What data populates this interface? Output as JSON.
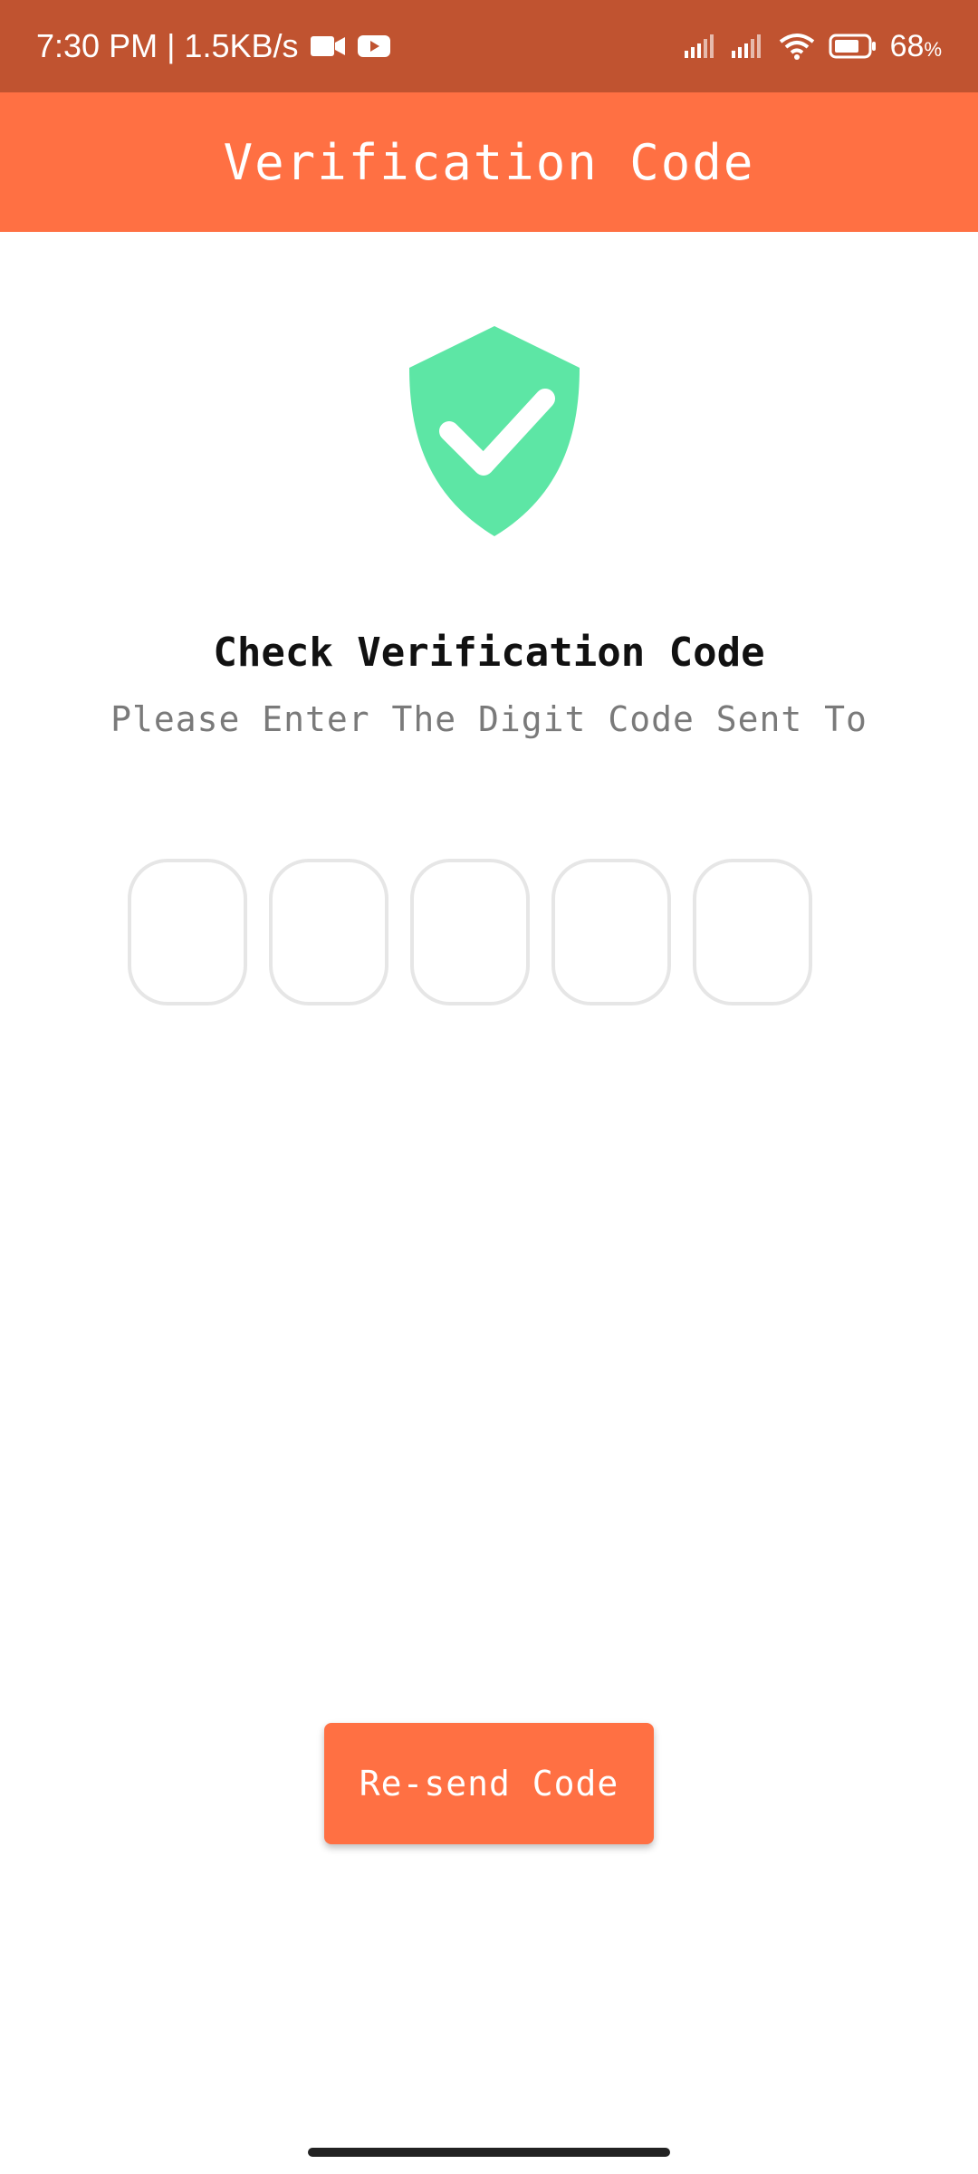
{
  "status_bar": {
    "time_speed": "7:30 PM | 1.5KB/s",
    "battery_value": "68",
    "battery_unit": "%",
    "icons": [
      "video-camera-icon",
      "youtube-icon",
      "signal-icon",
      "signal-icon",
      "wifi-icon",
      "battery-icon"
    ]
  },
  "app_bar": {
    "title": "Verification Code"
  },
  "main": {
    "icon": "shield-check-icon",
    "heading": "Check Verification Code",
    "subheading": "Please Enter The Digit Code Sent To",
    "otp_boxes": [
      "",
      "",
      "",
      "",
      ""
    ]
  },
  "actions": {
    "resend_label": "Re-send Code"
  },
  "colors": {
    "status_bar": "#C05330",
    "primary": "#FF7043",
    "shield": "#5DE6A5"
  }
}
